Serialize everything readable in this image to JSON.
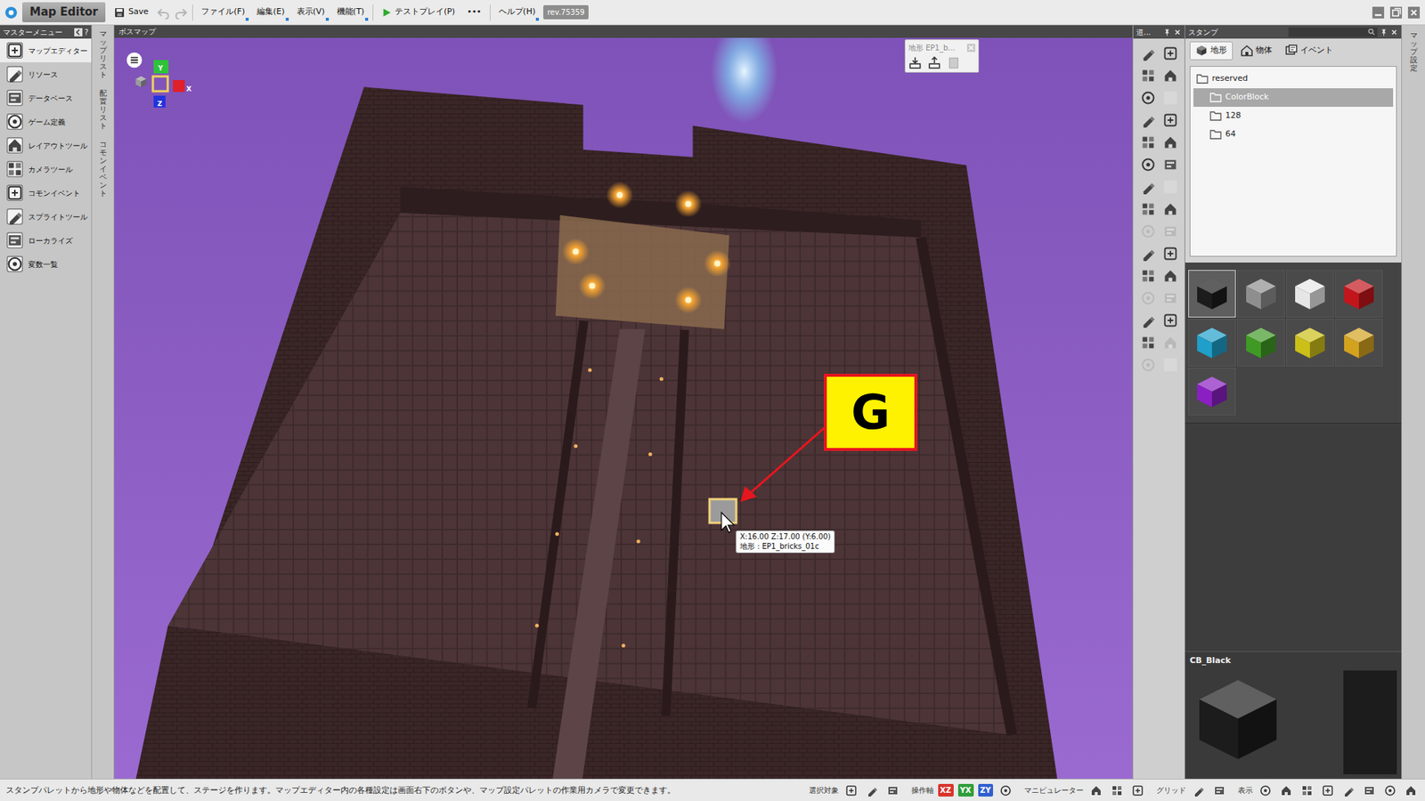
{
  "window": {
    "title": "Map Editor",
    "revision": "rev.75359"
  },
  "toolbar": {
    "save": "Save",
    "undo": {
      "disabled": true
    },
    "redo": {
      "disabled": true
    },
    "menus": [
      "ファイル(F)",
      "編集(E)",
      "表示(V)",
      "機能(T)"
    ],
    "testplay": "テストプレイ(P)",
    "more": "•••",
    "help": "ヘルプ(H)"
  },
  "master_menu": {
    "title": "マスターメニュー",
    "help": "?",
    "items": [
      {
        "label": "マップエディター",
        "selected": true
      },
      {
        "label": "リソース",
        "selected": false
      },
      {
        "label": "データベース",
        "selected": false
      },
      {
        "label": "ゲーム定義",
        "selected": false
      },
      {
        "label": "レイアウトツール",
        "selected": false
      },
      {
        "label": "カメラツール",
        "selected": false
      },
      {
        "label": "コモンイベント",
        "selected": false
      },
      {
        "label": "スプライトツール",
        "selected": false
      },
      {
        "label": "ローカライズ",
        "selected": false
      },
      {
        "label": "変数一覧",
        "selected": false
      }
    ]
  },
  "side_tabs": [
    "マップリスト",
    "配置リスト",
    "コモンイベント"
  ],
  "viewport": {
    "tab": "ボスマップ",
    "gizmo": {
      "y": "Y",
      "x": "X",
      "z": "Z"
    },
    "palette": {
      "title": "地形 EP1_b..."
    },
    "callout": "G",
    "tooltip": {
      "position": "X:16.00 Z:17.00 (Y:6.00)",
      "terrain": "地形 : EP1_bricks_01c"
    }
  },
  "tools_panel": {
    "title": "道...",
    "tools": [
      {
        "kind": "tool",
        "disabled": false
      },
      {
        "kind": "tool",
        "disabled": false
      },
      {
        "kind": "tool",
        "disabled": false
      },
      {
        "kind": "tool",
        "disabled": false
      },
      {
        "kind": "tool",
        "disabled": false
      },
      {
        "kind": "blank",
        "disabled": false
      },
      {
        "kind": "tool",
        "disabled": false
      },
      {
        "kind": "tool",
        "disabled": false
      },
      {
        "kind": "tool",
        "disabled": false
      },
      {
        "kind": "tool",
        "disabled": false
      },
      {
        "kind": "tool",
        "disabled": false
      },
      {
        "kind": "tool",
        "disabled": false
      },
      {
        "kind": "tool",
        "disabled": false
      },
      {
        "kind": "blank",
        "disabled": false
      },
      {
        "kind": "tool",
        "disabled": false
      },
      {
        "kind": "tool",
        "disabled": false
      },
      {
        "kind": "tool",
        "disabled": true
      },
      {
        "kind": "tool",
        "disabled": true
      },
      {
        "kind": "tool",
        "disabled": false
      },
      {
        "kind": "tool",
        "disabled": false
      },
      {
        "kind": "tool",
        "disabled": false
      },
      {
        "kind": "tool",
        "disabled": false
      },
      {
        "kind": "tool",
        "disabled": true
      },
      {
        "kind": "tool",
        "disabled": true
      },
      {
        "kind": "tool",
        "disabled": false
      },
      {
        "kind": "tool",
        "disabled": false
      },
      {
        "kind": "tool",
        "disabled": false
      },
      {
        "kind": "tool",
        "disabled": true
      },
      {
        "kind": "tool",
        "disabled": true
      },
      {
        "kind": "blank",
        "disabled": false
      }
    ]
  },
  "stamp": {
    "title": "スタンプ",
    "tabs": [
      {
        "label": "地形",
        "selected": true
      },
      {
        "label": "物体",
        "selected": false
      },
      {
        "label": "イベント",
        "selected": false
      }
    ],
    "tree": [
      {
        "label": "reserved",
        "depth": 0,
        "selected": false
      },
      {
        "label": "ColorBlock",
        "depth": 1,
        "selected": true
      },
      {
        "label": "128",
        "depth": 1,
        "selected": false
      },
      {
        "label": "64",
        "depth": 1,
        "selected": false
      }
    ],
    "swatches": [
      {
        "color": "#1c1c1c",
        "selected": true
      },
      {
        "color": "#8e8e8e",
        "selected": false
      },
      {
        "color": "#e6e6e6",
        "selected": false
      },
      {
        "color": "#c2161c",
        "selected": false
      },
      {
        "color": "#1f9fca",
        "selected": false
      },
      {
        "color": "#3f9a25",
        "selected": false
      },
      {
        "color": "#cbbf18",
        "selected": false
      },
      {
        "color": "#d3a21f",
        "selected": false
      },
      {
        "color": "#8a1fc2",
        "selected": false
      }
    ],
    "preview": {
      "label": "CB_Black"
    }
  },
  "map_settings_tab": "マップ設定",
  "status_bar": {
    "message": "スタンプパレットから地形や物体などを配置して、ステージを作ります。マップエディター内の各種設定は画面右下のボタンや、マップ設定パレットの作業用カメラで変更できます。",
    "groups": [
      {
        "label": "選択対象"
      },
      {
        "label": "操作軸"
      },
      {
        "label": "マニピュレーター"
      },
      {
        "label": "グリッド"
      },
      {
        "label": "表示"
      }
    ],
    "axes": [
      {
        "label": "XZ",
        "color": "#d9342b"
      },
      {
        "label": "YX",
        "color": "#2f9e3a"
      },
      {
        "label": "ZY",
        "color": "#2f5fd0"
      }
    ]
  }
}
